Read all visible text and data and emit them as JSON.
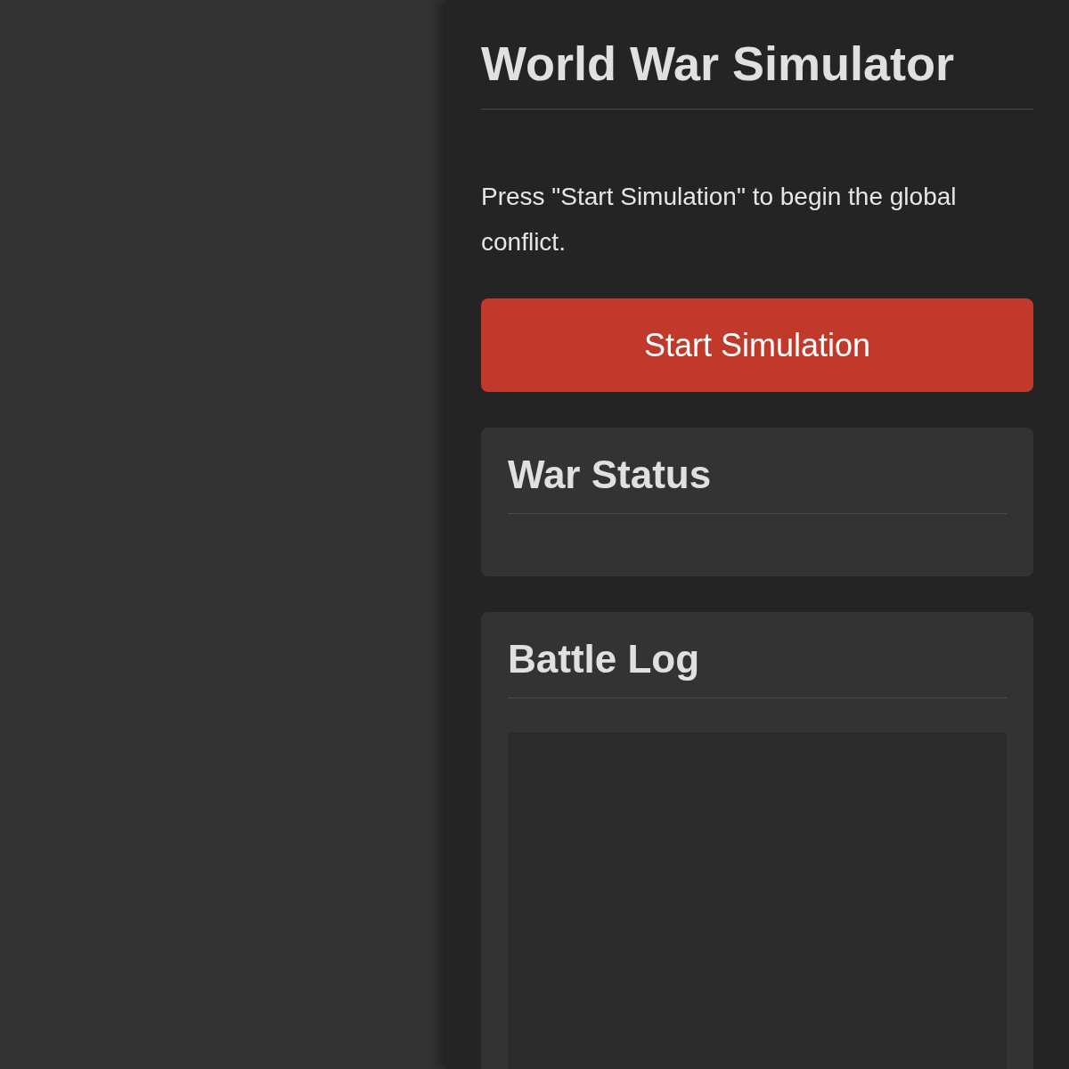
{
  "sidebar": {
    "title": "World War Simulator",
    "intro": "Press \"Start Simulation\" to begin the global conflict.",
    "start_button": "Start Simulation",
    "panels": [
      {
        "kind": "status",
        "title": "War Status"
      },
      {
        "kind": "log",
        "title": "Battle Log"
      }
    ]
  }
}
